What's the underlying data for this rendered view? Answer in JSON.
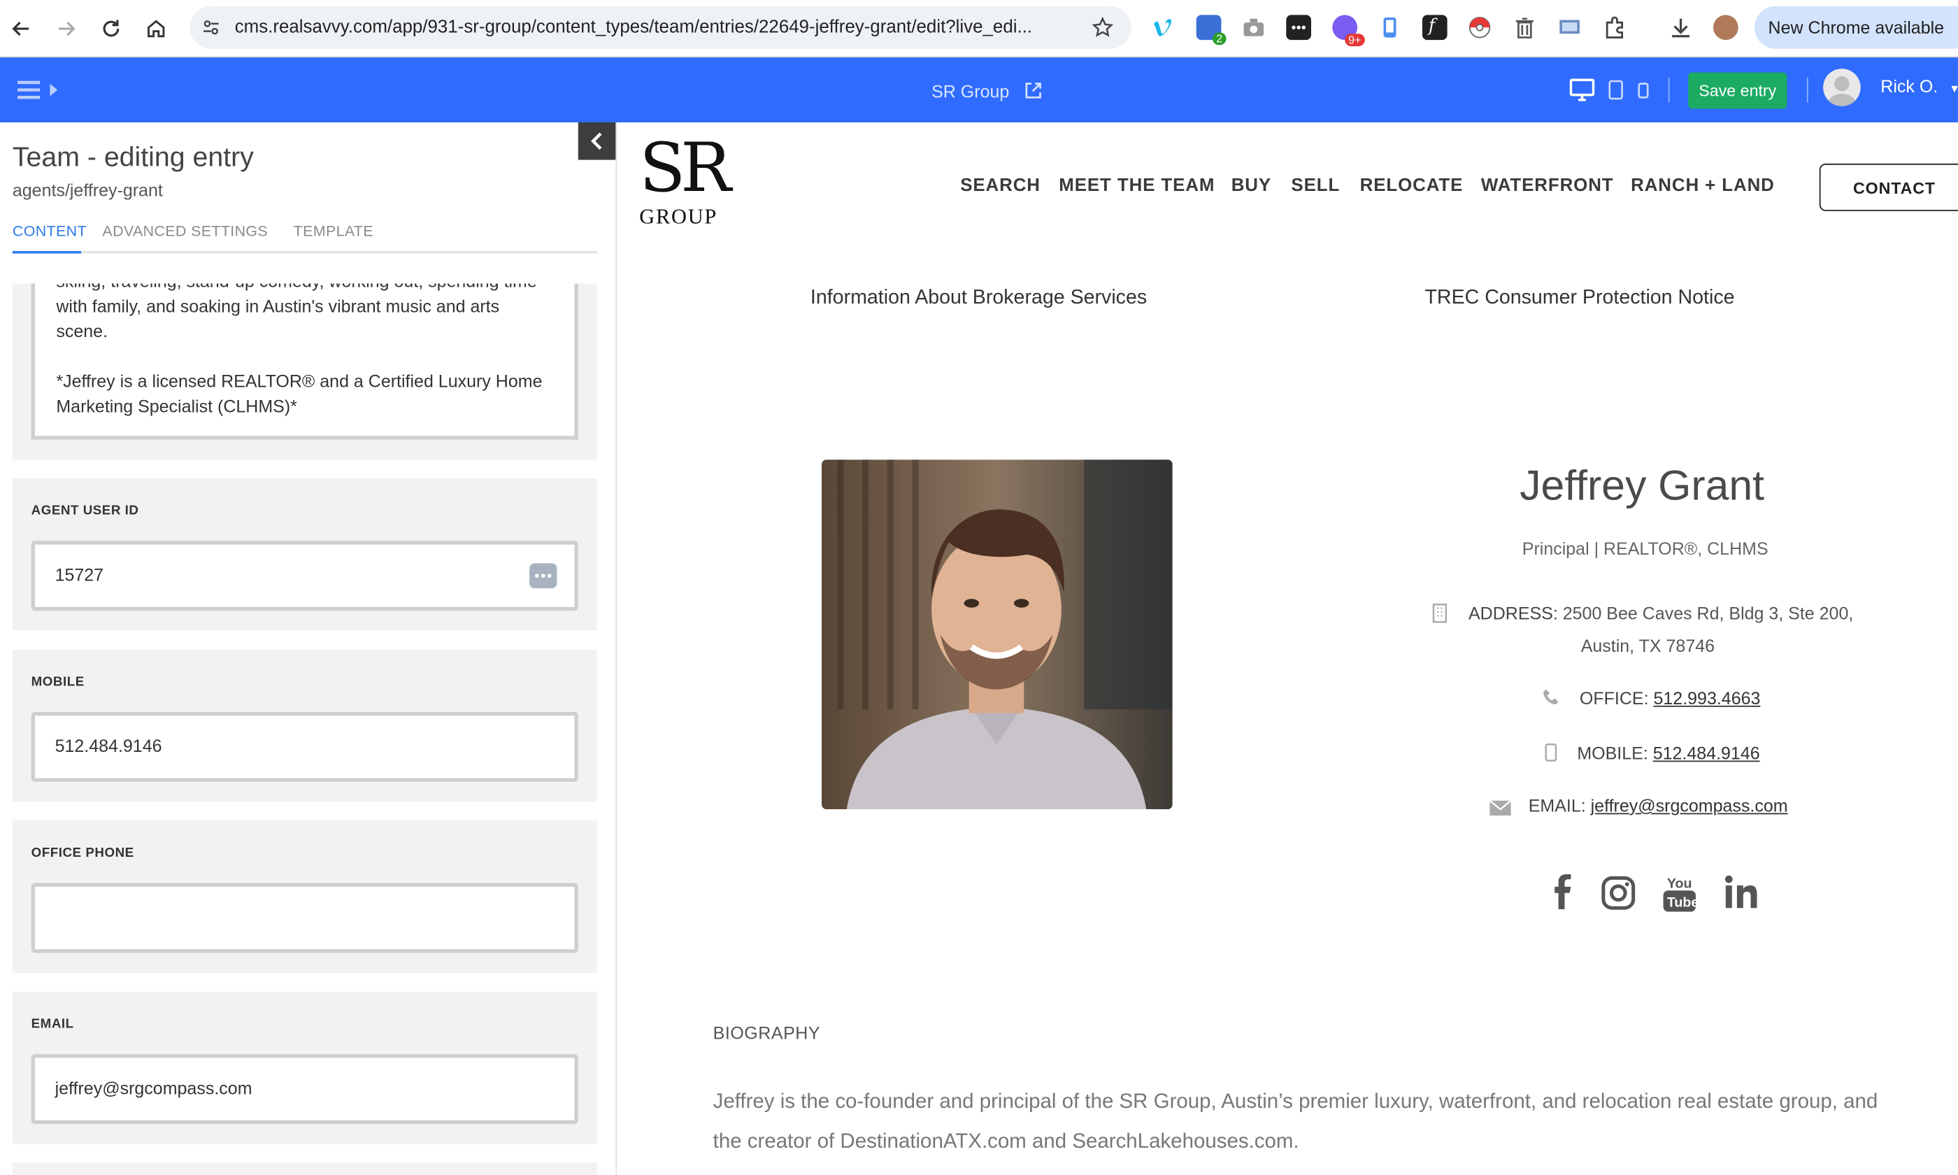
{
  "browser": {
    "url": "cms.realsavvy.com/app/931-sr-group/content_types/team/entries/22649-jeffrey-grant/edit?live_edi...",
    "chrome_update_label": "New Chrome available",
    "extension_badges": [
      "2",
      "9+"
    ]
  },
  "cms_header": {
    "site_name": "SR Group",
    "save_label": "Save entry",
    "user_name": "Rick O."
  },
  "editor": {
    "title": "Team - editing entry",
    "slug": "agents/jeffrey-grant",
    "tabs": [
      "CONTENT",
      "ADVANCED SETTINGS",
      "TEMPLATE"
    ],
    "bio_fragment_lines": [
      "skiing, traveling, stand-up comedy, working out, spending time",
      "with family, and soaking in Austin's vibrant music and arts",
      "scene.",
      "*Jeffrey is a licensed REALTOR® and a Certified Luxury Home",
      "Marketing Specialist (CLHMS)*"
    ],
    "fields": [
      {
        "label": "AGENT USER ID",
        "value": "15727"
      },
      {
        "label": "MOBILE",
        "value": "512.484.9146"
      },
      {
        "label": "OFFICE PHONE",
        "value": ""
      },
      {
        "label": "EMAIL",
        "value": "jeffrey@srgcompass.com"
      }
    ]
  },
  "site": {
    "logo_top": "SR",
    "logo_bottom": "GROUP",
    "nav": [
      "SEARCH",
      "MEET THE TEAM",
      "BUY",
      "SELL",
      "RELOCATE",
      "WATERFRONT",
      "RANCH + LAND"
    ],
    "contact_label": "CONTACT",
    "info_links": [
      "Information About Brokerage Services",
      "TREC Consumer Protection Notice"
    ],
    "agent": {
      "name": "Jeffrey Grant",
      "title": "Principal | REALTOR®, CLHMS",
      "address_label": "ADDRESS:",
      "address_line1": "2500 Bee Caves Rd, Bldg 3, Ste 200,",
      "address_line2": "Austin, TX 78746",
      "office_label": "OFFICE:",
      "office": "512.993.4663",
      "mobile_label": "MOBILE:",
      "mobile": "512.484.9146",
      "email_label": "EMAIL:",
      "email": "jeffrey@srgcompass.com"
    },
    "social_icons": [
      "facebook-icon",
      "instagram-icon",
      "youtube-icon",
      "linkedin-icon"
    ],
    "bio_heading": "BIOGRAPHY",
    "bio": "Jeffrey is the co-founder and principal of the SR Group, Austin’s premier luxury, waterfront, and relocation real estate group, and the creator of DestinationATX.com and SearchLakehouses.com."
  },
  "colors": {
    "cms_header": "#2f6bff",
    "save_button": "#1bab63",
    "active_tab": "#2f7bea"
  }
}
